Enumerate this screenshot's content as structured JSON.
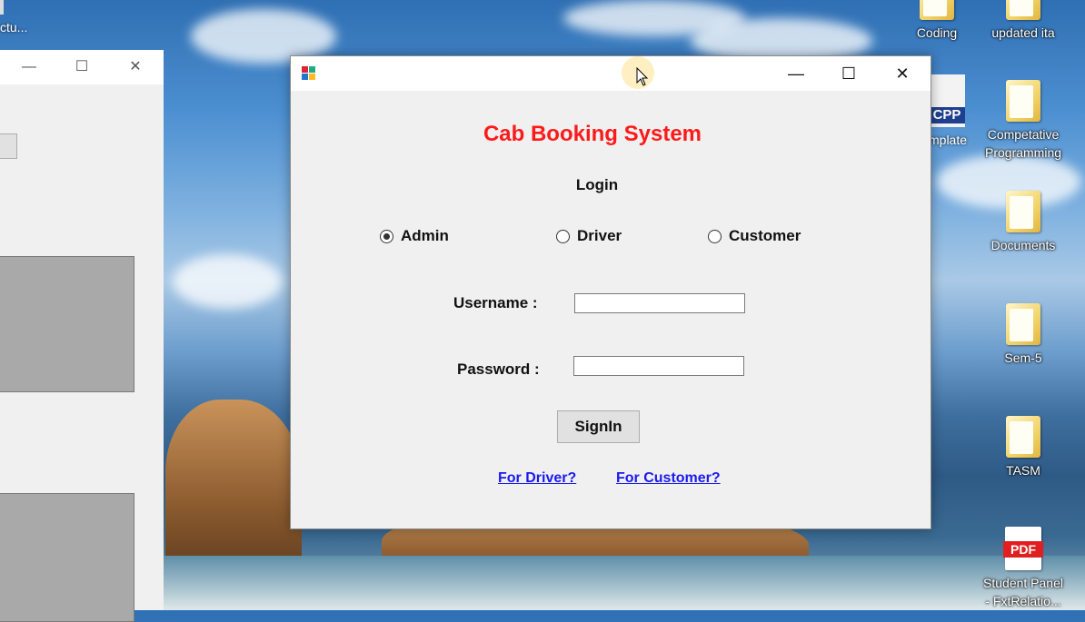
{
  "desktop": {
    "topleft_label": "ctu...",
    "icons": [
      {
        "label": "Coding",
        "type": "folder"
      },
      {
        "label": "updated ita",
        "type": "folder"
      },
      {
        "label": "mplate",
        "type": "cpp"
      },
      {
        "label": "Competative\nProgramming",
        "type": "folder"
      },
      {
        "label": "Documents",
        "type": "folder"
      },
      {
        "label": "Sem-5",
        "type": "folder"
      },
      {
        "label": "TASM",
        "type": "folder"
      },
      {
        "label": "Student Panel - FxtRelatio...",
        "type": "pdf"
      }
    ],
    "cpp_badge": "CPP",
    "pdf_badge": "PDF"
  },
  "bg_window": {
    "minimize": "—",
    "maximize": "☐",
    "close": "✕"
  },
  "dialog": {
    "minimize": "—",
    "maximize": "☐",
    "close": "✕",
    "title": "Cab Booking System",
    "heading": "Login",
    "roles": [
      {
        "label": "Admin",
        "checked": true
      },
      {
        "label": "Driver",
        "checked": false
      },
      {
        "label": "Customer",
        "checked": false
      }
    ],
    "username_label": "Username :",
    "username_value": "",
    "password_label": "Password :",
    "password_value": "",
    "signin_label": "SignIn",
    "link_driver": "For Driver?",
    "link_customer": "For Customer?"
  },
  "colors": {
    "title": "#ff1a1a",
    "link": "#1a1aee",
    "dialog_bg": "#f0f0f0"
  }
}
